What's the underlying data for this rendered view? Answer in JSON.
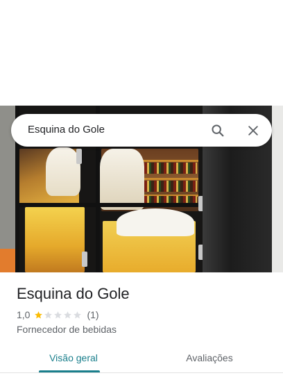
{
  "search": {
    "query": "Esquina do Gole",
    "search_icon": "search-icon",
    "close_icon": "close-icon"
  },
  "place": {
    "name": "Esquina do Gole",
    "rating": "1,0",
    "rating_value": 1,
    "rating_max": 5,
    "review_count": "(1)",
    "category": "Fornecedor de bebidas"
  },
  "tabs": [
    {
      "label": "Visão geral",
      "active": true
    },
    {
      "label": "Avaliações",
      "active": false
    }
  ],
  "colors": {
    "accent": "#1a7f8c",
    "star_filled": "#fbbc04",
    "star_empty": "#dadce0",
    "text_secondary": "#5f6368"
  }
}
